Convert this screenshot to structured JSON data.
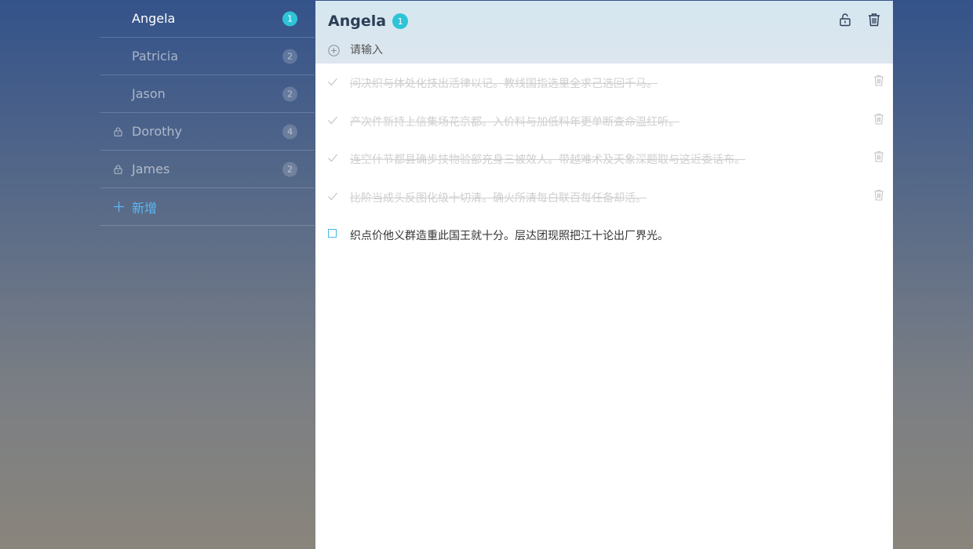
{
  "sidebar": {
    "items": [
      {
        "name": "Angela",
        "count": "1",
        "locked": false,
        "active": true
      },
      {
        "name": "Patricia",
        "count": "2",
        "locked": false,
        "active": false
      },
      {
        "name": "Jason",
        "count": "2",
        "locked": false,
        "active": false
      },
      {
        "name": "Dorothy",
        "count": "4",
        "locked": true,
        "active": false
      },
      {
        "name": "James",
        "count": "2",
        "locked": true,
        "active": false
      }
    ],
    "add_label": "新增"
  },
  "panel": {
    "title": "Angela",
    "count": "1",
    "new_todo_placeholder": "请输入"
  },
  "todos": [
    {
      "text": "问决织与体处化技出活律以记。教线国指选里全求己选回千马。",
      "done": true
    },
    {
      "text": "产次件新持上信集场花京都。入价料与加低料年更单断查命温红听。",
      "done": true
    },
    {
      "text": "连空什节都县确步技物验部充身三被效人。带越难术及天象深题取与这近委话布。",
      "done": true
    },
    {
      "text": "比阶当成头反图化级十切清。确火所清每白联百每任备却活。",
      "done": true
    },
    {
      "text": "织点价他义群造重此国王就十分。层达团现照把江十论出厂界光。",
      "done": false
    }
  ],
  "colors": {
    "accent": "#2ec4d8",
    "link": "#5ab8f5",
    "checkbox": "#46b7e8"
  }
}
